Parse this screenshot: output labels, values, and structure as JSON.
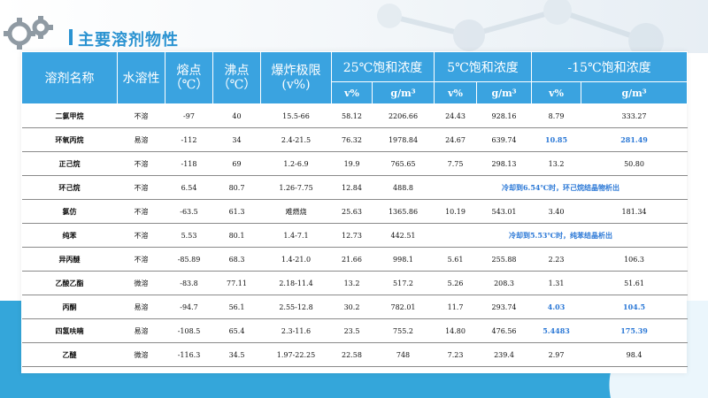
{
  "title": "主要溶剂物性",
  "colors": {
    "header_bg": "#3aa3e0",
    "accent": "#2b93d1",
    "highlight": "#2b78d6",
    "bottom_band": "#34a6da"
  },
  "icons": [
    "gear-icon"
  ],
  "header": {
    "solvent": "溶剂名称",
    "water_solubility": "水溶性",
    "melting_point": [
      "熔点",
      "（℃）"
    ],
    "boiling_point": [
      "沸点",
      "（℃）"
    ],
    "explosion_limit": [
      "爆炸极限",
      "(v%)"
    ],
    "sat_25": "25℃饱和浓度",
    "sat_5": "5℃饱和浓度",
    "sat_m15": "-15℃饱和浓度",
    "sub": {
      "v25": "v%",
      "g25": "g/m³",
      "v5": "v%",
      "g5": "g/m³",
      "vm15": "v%",
      "gm15": "g/m³"
    }
  },
  "rows": [
    {
      "name": "二氯甲烷",
      "water": "不溶",
      "mp": "-97",
      "bp": "40",
      "limit": "15.5-66",
      "v25": "58.12",
      "g25": "2206.66",
      "v5": "24.43",
      "g5": "928.16",
      "vm15": "8.79",
      "gm15": "333.27"
    },
    {
      "name": "环氧丙烷",
      "water": "易溶",
      "mp": "-112",
      "bp": "34",
      "limit": "2.4-21.5",
      "v25": "76.32",
      "g25": "1978.84",
      "v5": "24.67",
      "g5": "639.74",
      "vm15": "10.85",
      "gm15": "281.49"
    },
    {
      "name": "正己烷",
      "water": "不溶",
      "mp": "-118",
      "bp": "69",
      "limit": "1.2-6.9",
      "v25": "19.9",
      "g25": "765.65",
      "v5": "7.75",
      "g5": "298.13",
      "vm15": "13.2",
      "gm15": "50.80"
    },
    {
      "name": "环己烷",
      "water": "不溶",
      "mp": "6.54",
      "bp": "80.7",
      "limit": "1.26-7.75",
      "v25": "12.84",
      "g25": "488.8",
      "note": "冷却到6.54℃时，环己烷结晶物析出"
    },
    {
      "name": "氯仿",
      "water": "不溶",
      "mp": "-63.5",
      "bp": "61.3",
      "limit": "难燃烧",
      "v25": "25.63",
      "g25": "1365.86",
      "v5": "10.19",
      "g5": "543.01",
      "vm15": "3.40",
      "gm15": "181.34"
    },
    {
      "name": "纯苯",
      "water": "不溶",
      "mp": "5.53",
      "bp": "80.1",
      "limit": "1.4-7.1",
      "v25": "12.73",
      "g25": "442.51",
      "note": "冷却到5.53℃时，纯苯结晶析出"
    },
    {
      "name": "异丙醚",
      "water": "不溶",
      "mp": "-85.89",
      "bp": "68.3",
      "limit": "1.4-21.0",
      "v25": "21.66",
      "g25": "998.1",
      "v5": "5.61",
      "g5": "255.88",
      "vm15": "2.23",
      "gm15": "106.3"
    },
    {
      "name": "乙酸乙酯",
      "water": "微溶",
      "mp": "-83.8",
      "bp": "77.11",
      "limit": "2.18-11.4",
      "v25": "13.2",
      "g25": "517.2",
      "v5": "5.26",
      "g5": "208.3",
      "vm15": "1.31",
      "gm15": "51.61"
    },
    {
      "name": "丙酮",
      "water": "易溶",
      "mp": "-94.7",
      "bp": "56.1",
      "limit": "2.55-12.8",
      "v25": "30.2",
      "g25": "782.01",
      "v5": "11.7",
      "g5": "293.74",
      "vm15": "4.03",
      "gm15": "104.5"
    },
    {
      "name": "四氢呋喃",
      "water": "易溶",
      "mp": "-108.5",
      "bp": "65.4",
      "limit": "2.3-11.6",
      "v25": "23.5",
      "g25": "755.2",
      "v5": "14.80",
      "g5": "476.56",
      "vm15": "5.4483",
      "gm15": "175.39"
    },
    {
      "name": "乙醚",
      "water": "微溶",
      "mp": "-116.3",
      "bp": "34.5",
      "limit": "1.97-22.25",
      "v25": "22.58",
      "g25": "748",
      "v5": "7.23",
      "g5": "239.4",
      "vm15": "2.97",
      "gm15": "98.4"
    }
  ]
}
